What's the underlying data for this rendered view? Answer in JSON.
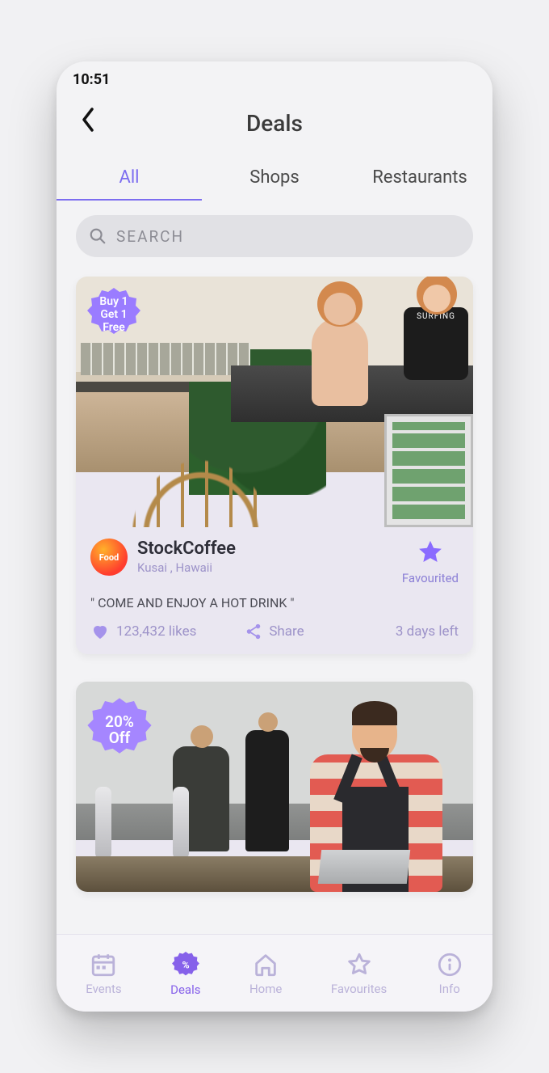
{
  "statusBar": {
    "time": "10:51"
  },
  "header": {
    "title": "Deals"
  },
  "tabs": [
    {
      "label": "All",
      "active": true
    },
    {
      "label": "Shops",
      "active": false
    },
    {
      "label": "Restaurants",
      "active": false
    }
  ],
  "search": {
    "placeholder": "SEARCH"
  },
  "colors": {
    "accent": "#8a6bff"
  },
  "deals": [
    {
      "badge": "Buy 1\nGet 1\nFree",
      "avatarText": "Food",
      "name": "StockCoffee",
      "location": "Kusai , Hawaii",
      "slogan": "\" COME AND ENJOY A HOT DRINK \"",
      "likes": "123,432 likes",
      "shareLabel": "Share",
      "timeLeft": "3 days left",
      "favLabel": "Favourited"
    },
    {
      "badge": "20%\nOff"
    }
  ],
  "bottomNav": [
    {
      "label": "Events",
      "active": false
    },
    {
      "label": "Deals",
      "active": true
    },
    {
      "label": "Home",
      "active": false
    },
    {
      "label": "Favourites",
      "active": false
    },
    {
      "label": "Info",
      "active": false
    }
  ]
}
